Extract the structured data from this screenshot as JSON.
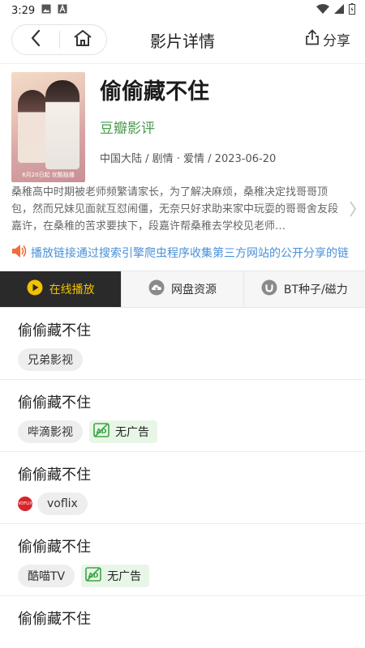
{
  "status": {
    "time": "3:29"
  },
  "nav": {
    "title": "影片详情",
    "share_label": "分享"
  },
  "movie": {
    "title": "偷偷藏不住",
    "rating_link": "豆瓣影评",
    "meta": "中国大陆 / 剧情 · 爱情 / 2023-06-20",
    "poster_caption": "6月20日起 优酷独播",
    "synopsis": "桑稚高中时期被老师频繁请家长，为了解决麻烦，桑稚决定找哥哥顶包，然而兄妹见面就互怼闹僵，无奈只好求助来家中玩耍的哥哥舍友段嘉许，在桑稚的苦求要挟下，段嘉许帮桑稚去学校见老师…"
  },
  "notice": "播放链接通过搜索引擎爬虫程序收集第三方网站的公开分享的链",
  "tabs": [
    {
      "label": "在线播放",
      "icon": "play-icon",
      "active": true
    },
    {
      "label": "网盘资源",
      "icon": "cloud-icon",
      "active": false
    },
    {
      "label": "BT种子/磁力",
      "icon": "magnet-icon",
      "active": false
    }
  ],
  "sources": [
    {
      "title": "偷偷藏不住",
      "source": "兄弟影视",
      "no_ad": ""
    },
    {
      "title": "偷偷藏不住",
      "source": "哔滴影视",
      "no_ad": "无广告"
    },
    {
      "title": "偷偷藏不住",
      "source": "voflix",
      "no_ad": "",
      "logo_text": "VOFLIX"
    },
    {
      "title": "偷偷藏不住",
      "source": "酷喵TV",
      "no_ad": "无广告"
    },
    {
      "title": "偷偷藏不住",
      "source": "",
      "no_ad": ""
    }
  ],
  "colors": {
    "accent_yellow": "#f2c200",
    "douban_green": "#4a9a4f",
    "notice_blue": "#4a90d9",
    "active_tab_bg": "#2a2a2a"
  }
}
